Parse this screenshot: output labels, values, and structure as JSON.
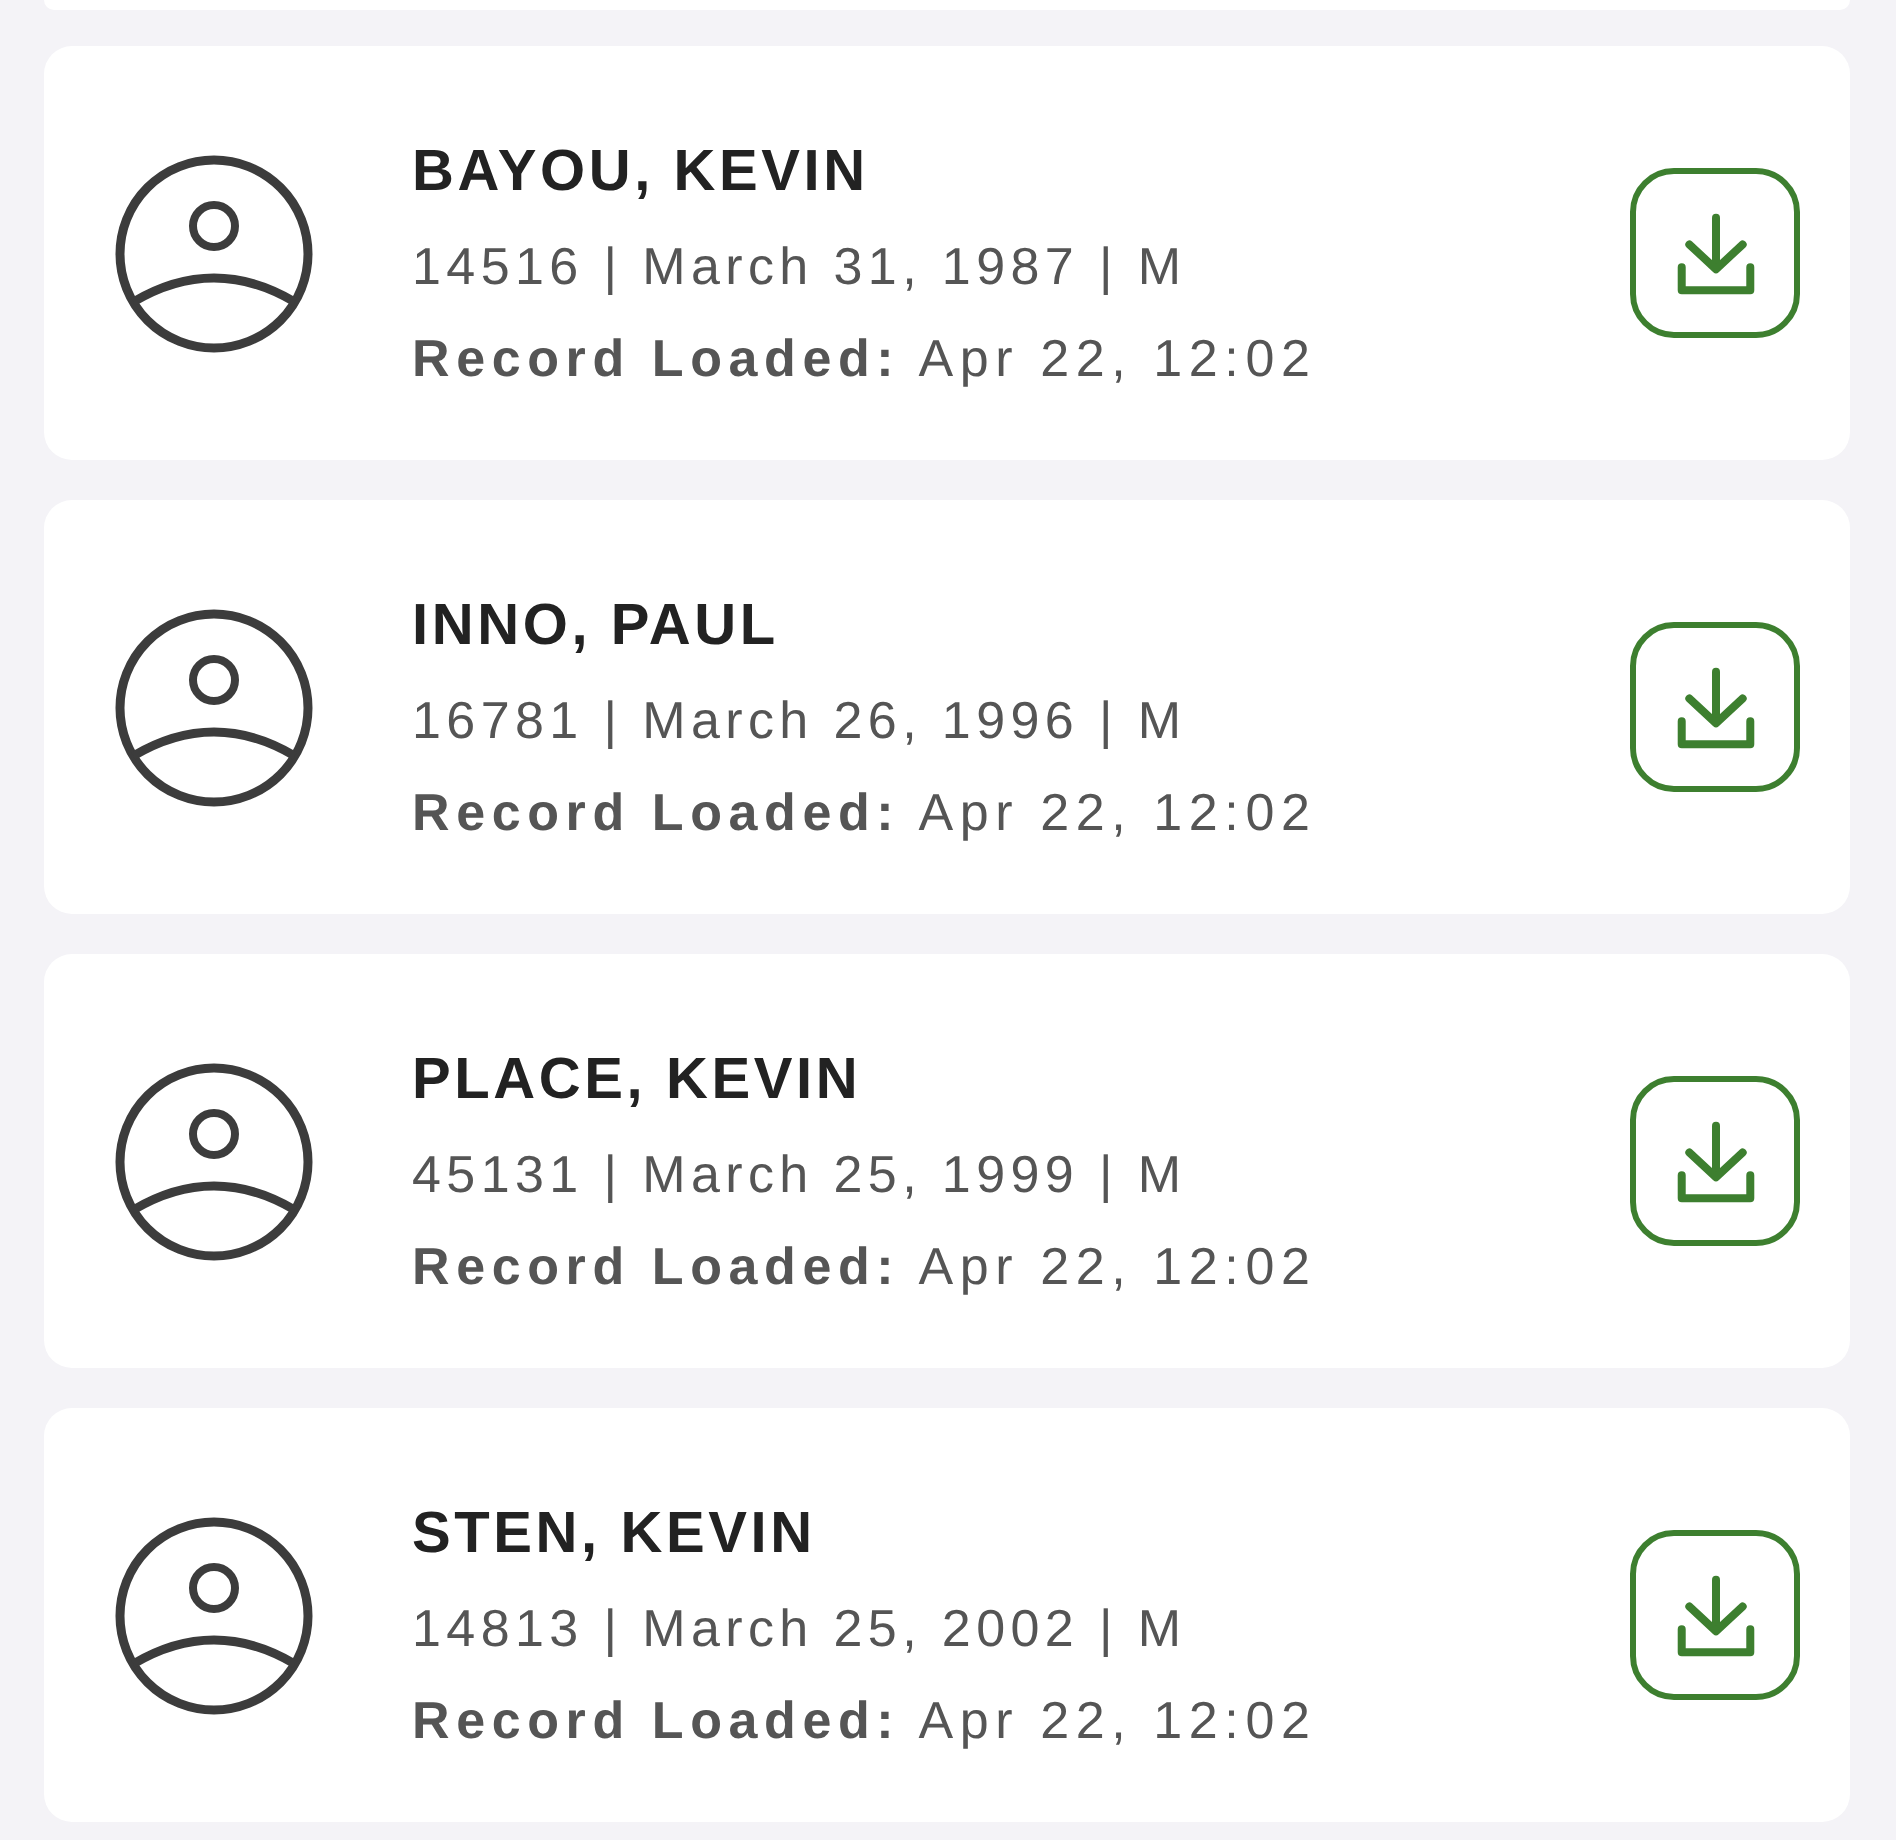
{
  "patients": [
    {
      "name": "BAYOU, KEVIN",
      "details": "14516 | March 31, 1987 | M",
      "record_loaded": "**Record Loaded:** Apr 22, 12:02"
    },
    {
      "name": "INNO, PAUL",
      "details": "16781 | March 26, 1996 | M",
      "record_loaded": "**Record Loaded:** Apr 22, 12:02"
    },
    {
      "name": "PLACE, KEVIN",
      "details": "45131 | March 25, 1999 | M",
      "record_loaded": "**Record Loaded:** Apr 22, 12:02"
    },
    {
      "name": "STEN, KEVIN",
      "details": "14813 | March 25, 2002 | M",
      "record_loaded": "**Record Loaded:** Apr 22, 12:02"
    }
  ]
}
